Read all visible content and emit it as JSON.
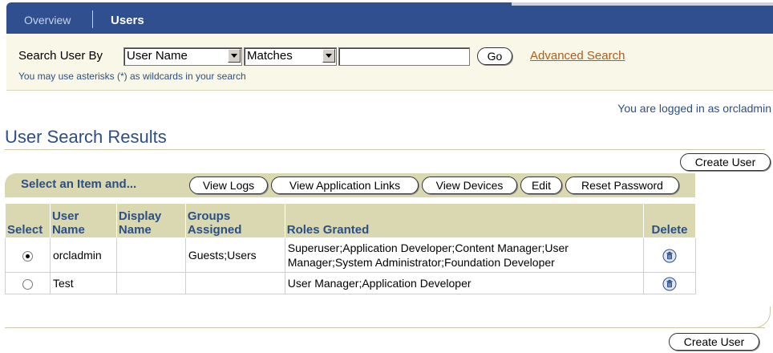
{
  "tabs": {
    "overview": "Overview",
    "users": "Users"
  },
  "search": {
    "label": "Search User By",
    "field_selected": "User Name",
    "match_selected": "Matches",
    "query_value": "",
    "go_label": "Go",
    "advanced_link": "Advanced Search",
    "hint": "You may use asterisks (*) as wildcards in your search"
  },
  "logged_in_text": "You are logged in as orcladmin",
  "page_title": "User Search Results",
  "create_user_label": "Create User",
  "action_bar": {
    "label": "Select an Item and...",
    "buttons": [
      "View Logs",
      "View Application Links",
      "View Devices",
      "Edit",
      "Reset Password"
    ]
  },
  "table": {
    "headers": {
      "select": "Select",
      "user_name": "User Name",
      "display_name": "Display Name",
      "groups": "Groups Assigned",
      "roles": "Roles Granted",
      "delete": "Delete"
    },
    "rows": [
      {
        "selected": true,
        "user_name": "orcladmin",
        "display_name": "",
        "groups": "Guests;Users",
        "roles": "Superuser;Application Developer;Content Manager;User Manager;System Administrator;Foundation Developer"
      },
      {
        "selected": false,
        "user_name": "Test",
        "display_name": "",
        "groups": "",
        "roles": "User Manager;Application Developer"
      }
    ]
  },
  "colors": {
    "tab_navy": "#2f4f8f",
    "heading_blue": "#2b4f86",
    "link_orange": "#b35b19",
    "header_beige": "#d9d8b0"
  },
  "icons": {
    "delete": "trash-icon",
    "select": "radio-button"
  }
}
